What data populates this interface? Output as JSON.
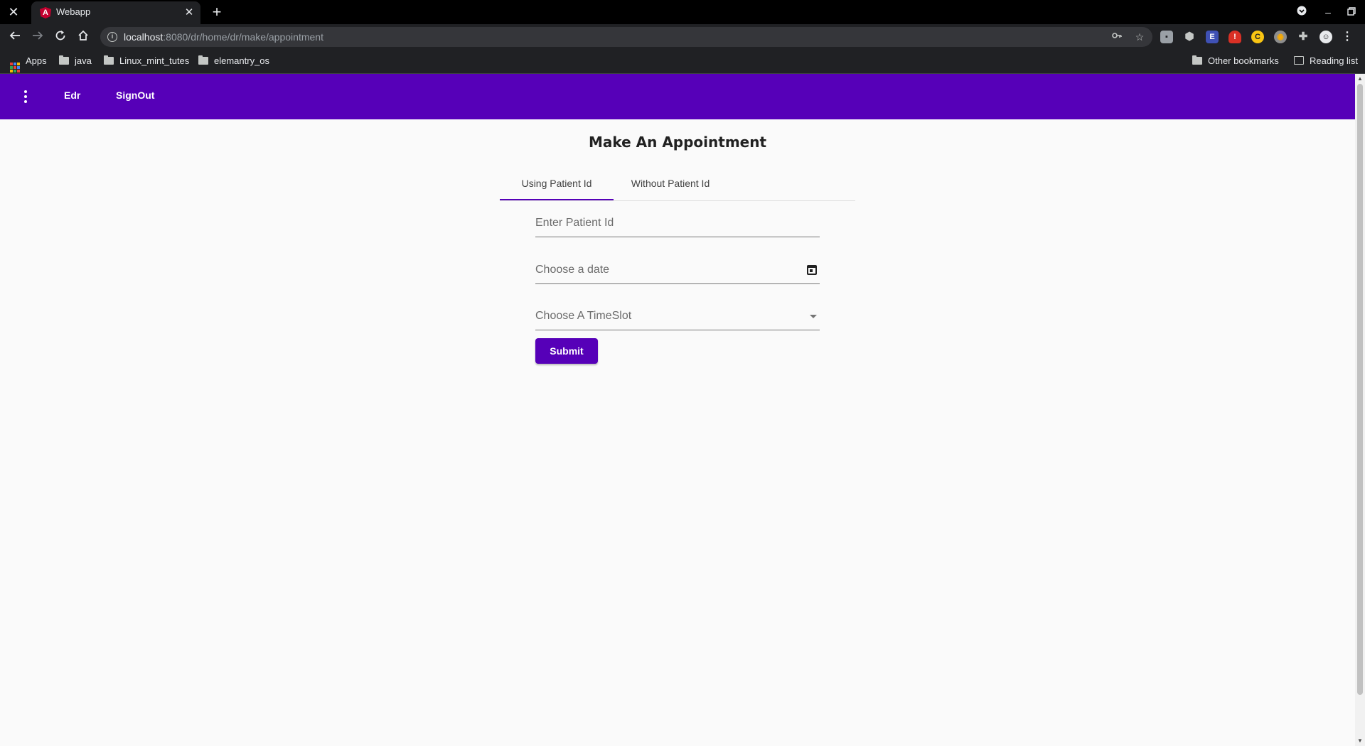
{
  "browser": {
    "tab_title": "Webapp",
    "url_host": "localhost",
    "url_rest": ":8080/dr/home/dr/make/appointment",
    "bookmarks": {
      "apps": "Apps",
      "items": [
        "java",
        "Linux_mint_tutes",
        "elemantry_os"
      ],
      "other": "Other bookmarks",
      "reading_list": "Reading list"
    }
  },
  "appbar": {
    "links": [
      "Edr",
      "SignOut"
    ],
    "color": "#5600b8"
  },
  "page": {
    "title": "Make An Appointment",
    "tabs": [
      "Using Patient Id",
      "Without Patient Id"
    ],
    "active_tab": "Using Patient Id",
    "fields": {
      "patient_id_placeholder": "Enter Patient Id",
      "date_placeholder": "Choose a date",
      "timeslot_placeholder": "Choose A TimeSlot"
    },
    "submit_label": "Submit"
  }
}
